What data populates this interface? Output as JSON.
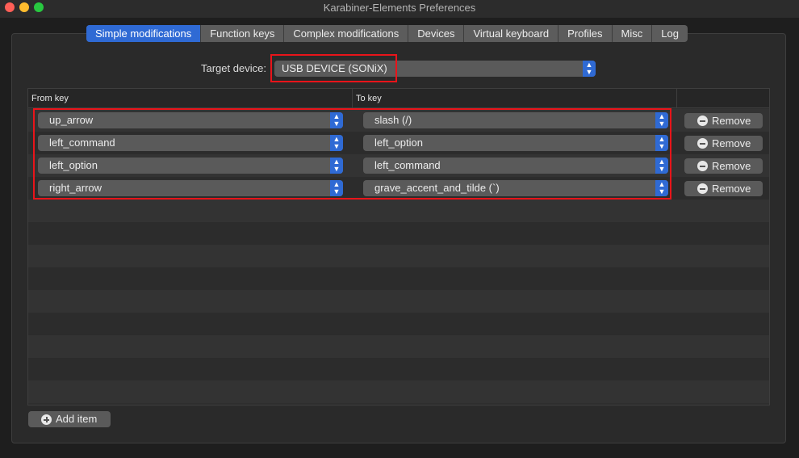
{
  "window": {
    "title": "Karabiner-Elements Preferences"
  },
  "tabs": [
    {
      "label": "Simple modifications",
      "active": true
    },
    {
      "label": "Function keys",
      "active": false
    },
    {
      "label": "Complex modifications",
      "active": false
    },
    {
      "label": "Devices",
      "active": false
    },
    {
      "label": "Virtual keyboard",
      "active": false
    },
    {
      "label": "Profiles",
      "active": false
    },
    {
      "label": "Misc",
      "active": false
    },
    {
      "label": "Log",
      "active": false
    }
  ],
  "target_device": {
    "label": "Target device:",
    "value": "USB DEVICE (SONiX)"
  },
  "table": {
    "columns": [
      "From key",
      "To key"
    ],
    "rows": [
      {
        "from": "up_arrow",
        "to": "slash (/)",
        "remove_label": "Remove"
      },
      {
        "from": "left_command",
        "to": "left_option",
        "remove_label": "Remove"
      },
      {
        "from": "left_option",
        "to": "left_command",
        "remove_label": "Remove"
      },
      {
        "from": "right_arrow",
        "to": "grave_accent_and_tilde (`)",
        "remove_label": "Remove"
      }
    ]
  },
  "add_item": {
    "label": "Add item"
  },
  "colors": {
    "accent": "#2f6ad4",
    "highlight": "#e8141a",
    "background": "#1e1e1e",
    "panel": "#2a2a2a"
  },
  "icons": {
    "select_chevron": "chevron-up-down-icon",
    "remove": "minus-circle-icon",
    "add": "plus-circle-icon"
  }
}
